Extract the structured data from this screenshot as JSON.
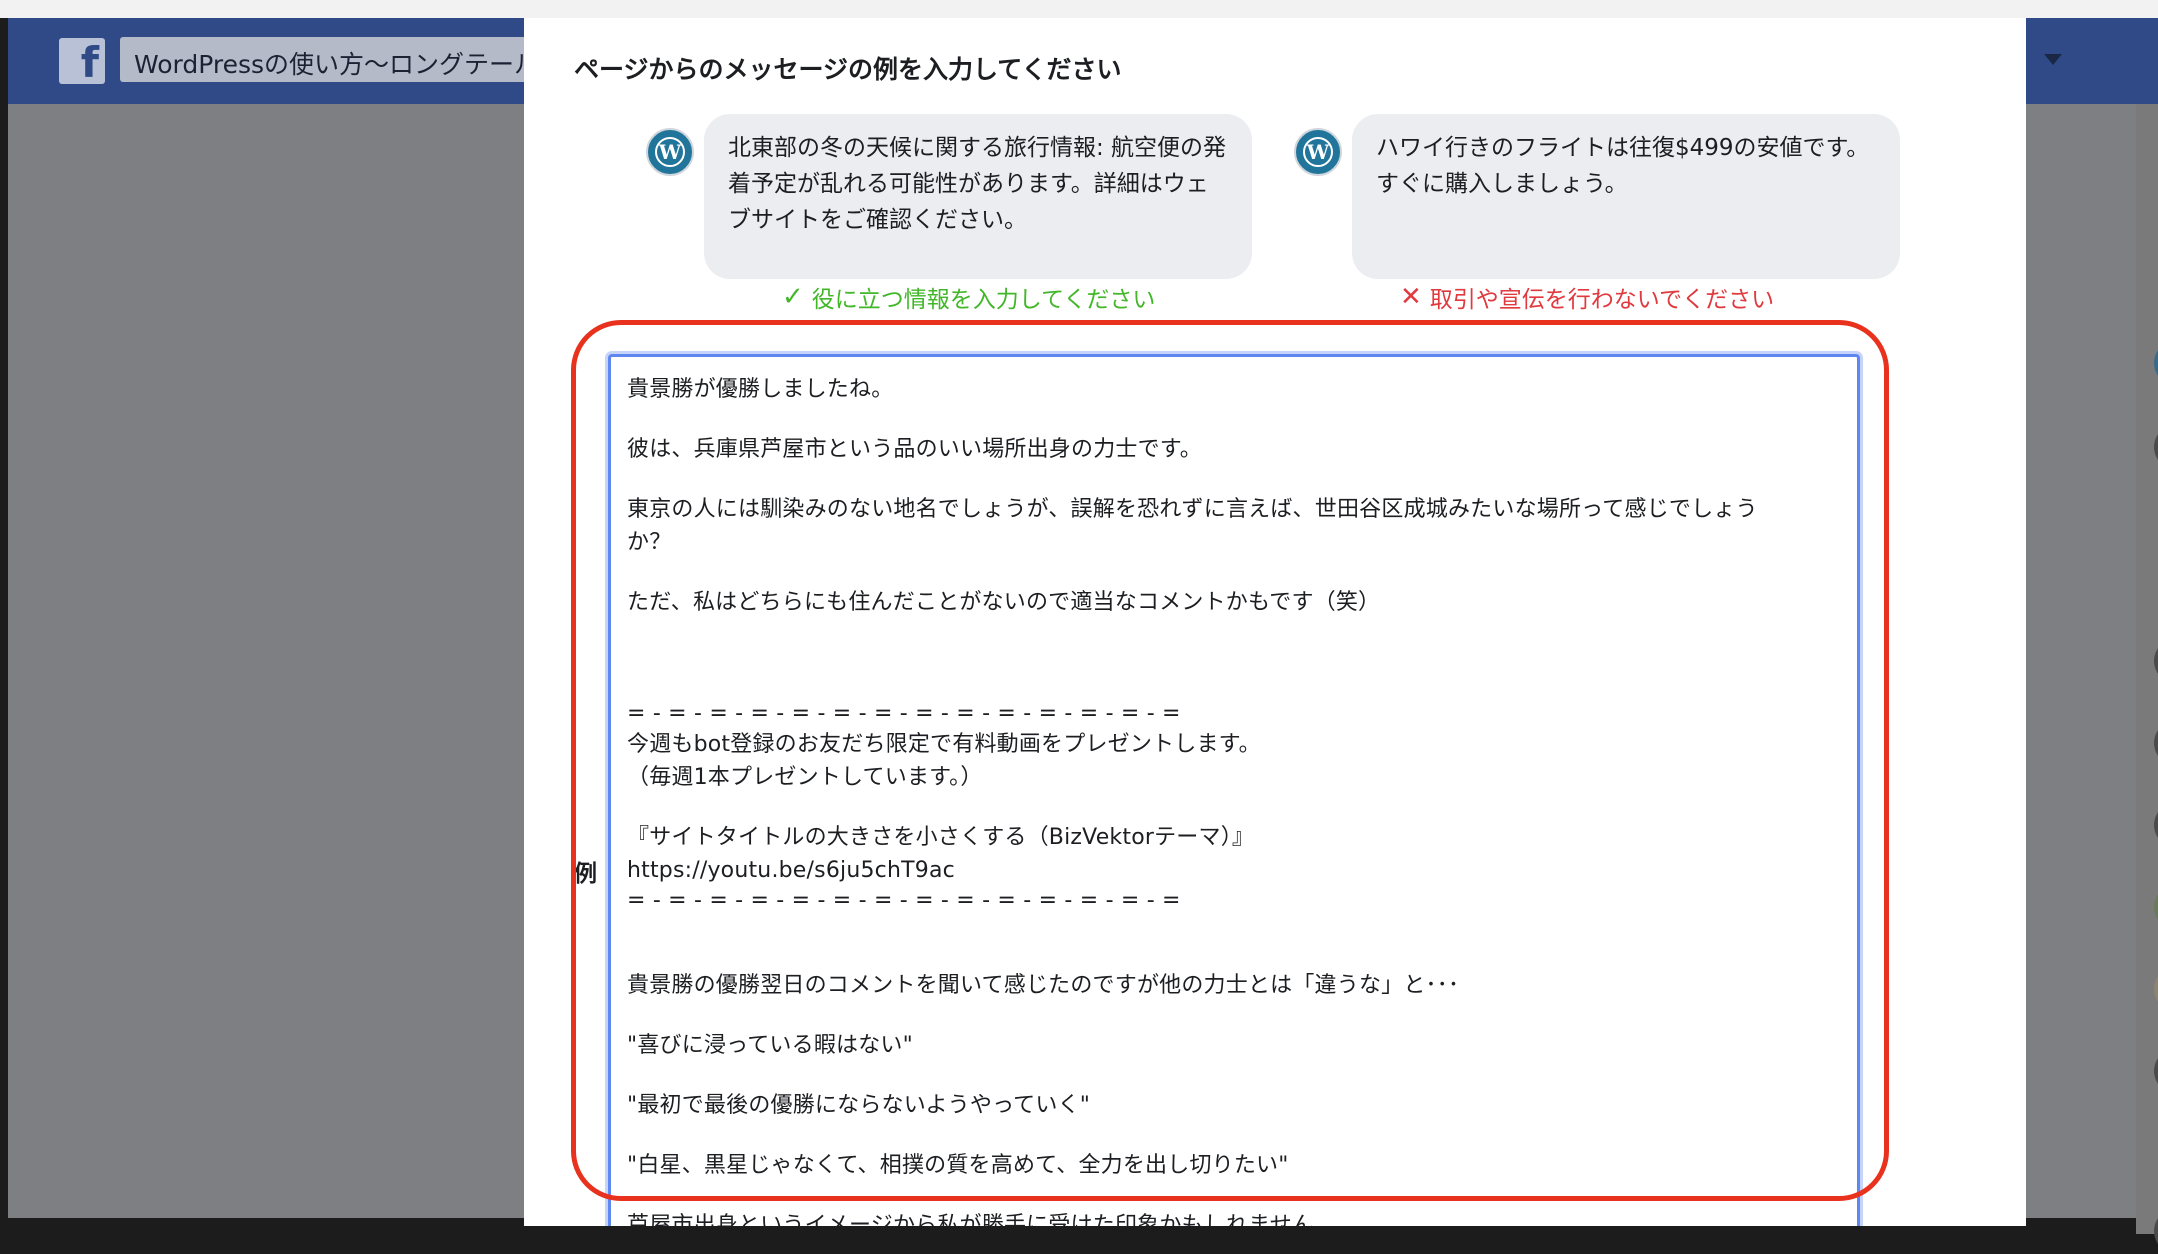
{
  "background_page": {
    "logo_glyph": "f",
    "page_title": "WordPressの使い方〜ロングテール"
  },
  "modal": {
    "title": "ページからのメッセージの例を入力してください",
    "examples": [
      {
        "avatar_label": "WordPress",
        "text": "北東部の冬の天候に関する旅行情報: 航空便の発着予定が乱れる可能性があります。詳細はウェブサイトをご確認ください。",
        "verdict_icon": "✓",
        "verdict": "役に立つ情報を入力してください",
        "verdict_color": "#42b72a"
      },
      {
        "avatar_label": "WordPress",
        "text": "ハワイ行きのフライトは往復$499の安値です。すぐに購入しましょう。",
        "verdict_icon": "✕",
        "verdict": "取引や宣伝を行わないでください",
        "verdict_color": "#e0393e"
      }
    ],
    "example_label": "例",
    "message_lines": [
      "貴景勝が優勝しましたね。",
      "",
      "彼は、兵庫県芦屋市という品のいい場所出身の力士です。",
      "",
      "東京の人には馴染みのない地名でしょうが、誤解を恐れずに言えば、世田谷区成城みたいな場所って感じでしょう",
      "か？",
      "",
      "ただ、私はどちらにも住んだことがないので適当なコメントかもです（笑）",
      "",
      "",
      "",
      "= - = - = - = - = - = - = - = - = - = - = - = - = - =",
      "今週もbot登録のお友だち限定で有料動画をプレゼントします。",
      "（毎週1本プレゼントしています。）",
      "",
      "『サイトタイトルの大きさを小さくする（BizVektorテーマ）』",
      "https://youtu.be/s6ju5chT9ac",
      "= - = - = - = - = - = - = - = - = - = - = - = - = - =",
      "",
      "",
      "貴景勝の優勝翌日のコメントを聞いて感じたのですが他の力士とは「違うな」と･･･",
      "",
      "\"喜びに浸っている暇はない\"",
      "",
      "\"最初で最後の優勝にならないようやっていく\"",
      "",
      "\"白星、黒星じゃなくて、相撲の質を高めて、全力を出し切りたい\"",
      "",
      "芦屋市出身というイメージから私が勝手に受けた印象かもしれません。"
    ]
  },
  "annotation": {
    "highlight_color": "#e8321e"
  }
}
